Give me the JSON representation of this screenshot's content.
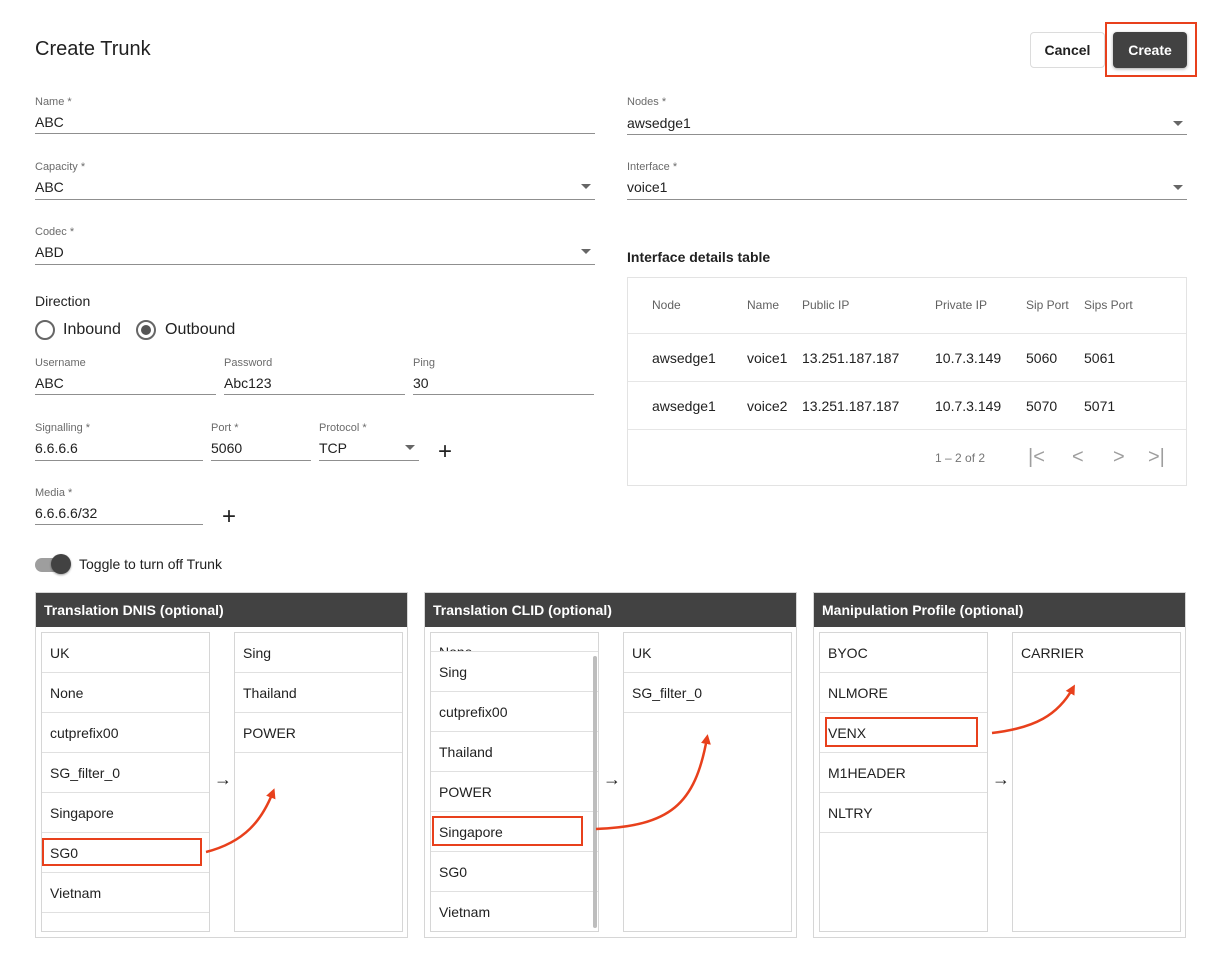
{
  "header": {
    "title": "Create Trunk",
    "cancel_label": "Cancel",
    "create_label": "Create"
  },
  "form": {
    "name": {
      "label": "Name *",
      "value": "ABC"
    },
    "nodes": {
      "label": "Nodes *",
      "value": "awsedge1"
    },
    "capacity": {
      "label": "Capacity *",
      "value": "ABC"
    },
    "interface": {
      "label": "Interface *",
      "value": "voice1"
    },
    "codec": {
      "label": "Codec *",
      "value": "ABD"
    },
    "direction": {
      "label": "Direction",
      "inbound": "Inbound",
      "outbound": "Outbound",
      "selected": "Outbound"
    },
    "username": {
      "label": "Username",
      "value": "ABC"
    },
    "password": {
      "label": "Password",
      "value": "Abc123"
    },
    "ping": {
      "label": "Ping",
      "value": "30"
    },
    "signalling": {
      "label": "Signalling *",
      "value": "6.6.6.6"
    },
    "port": {
      "label": "Port *",
      "value": "5060"
    },
    "protocol": {
      "label": "Protocol *",
      "value": "TCP"
    },
    "media": {
      "label": "Media *",
      "value": "6.6.6.6/32"
    },
    "toggle": {
      "label": "Toggle to turn off Trunk",
      "on": true
    }
  },
  "interface_table": {
    "title": "Interface details table",
    "columns": [
      "Node",
      "Name",
      "Public IP",
      "Private IP",
      "Sip Port",
      "Sips Port"
    ],
    "rows": [
      [
        "awsedge1",
        "voice1",
        "13.251.187.187",
        "10.7.3.149",
        "5060",
        "5061"
      ],
      [
        "awsedge1",
        "voice2",
        "13.251.187.187",
        "10.7.3.149",
        "5070",
        "5071"
      ]
    ],
    "pagination": "1 – 2 of 2"
  },
  "panels": {
    "dnis": {
      "title": "Translation DNIS (optional)",
      "available": [
        "UK",
        "None",
        "cutprefix00",
        "SG_filter_0",
        "Singapore",
        "SG0",
        "Vietnam"
      ],
      "selected": [
        "Sing",
        "Thailand",
        "POWER"
      ],
      "highlighted": "SG0"
    },
    "clid": {
      "title": "Translation CLID (optional)",
      "partial_top": "None",
      "available": [
        "Sing",
        "cutprefix00",
        "Thailand",
        "POWER",
        "Singapore",
        "SG0",
        "Vietnam"
      ],
      "selected": [
        "UK",
        "SG_filter_0"
      ],
      "highlighted": "Singapore"
    },
    "manipulation": {
      "title": "Manipulation Profile (optional)",
      "available": [
        "BYOC",
        "NLMORE",
        "VENX",
        "M1HEADER",
        "NLTRY"
      ],
      "selected": [
        "CARRIER"
      ],
      "highlighted": "VENX"
    }
  },
  "colors": {
    "accent_dark": "#424242",
    "highlight": "#e8401c"
  },
  "icons": {
    "plus": "+",
    "arrow": "→",
    "first": "|<",
    "prev": "<",
    "next": ">",
    "last": ">|"
  }
}
